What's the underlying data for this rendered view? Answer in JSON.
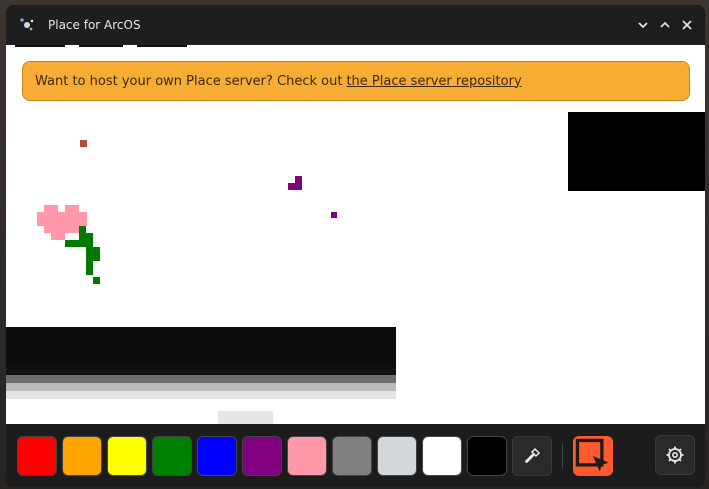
{
  "window": {
    "title": "Place for ArcOS",
    "icon": "place-app-icon",
    "controls": [
      "minimize-icon",
      "maximize-icon",
      "close-icon"
    ]
  },
  "banner": {
    "text": "Want to host your own Place server? Check out",
    "link_text": "the Place server repository"
  },
  "palette": {
    "colors": [
      "#ff0000",
      "#ffa500",
      "#ffff00",
      "#008000",
      "#0000ff",
      "#800080",
      "#ff99aa",
      "#808080",
      "#d3d7da",
      "#ffffff",
      "#000000"
    ]
  },
  "tools": {
    "eyedropper": "eyedropper-icon",
    "select": "select-cursor-icon",
    "settings": "gear-icon"
  },
  "colors": {
    "accent": "#ff5a2e",
    "banner_bg": "#f7ac33"
  }
}
